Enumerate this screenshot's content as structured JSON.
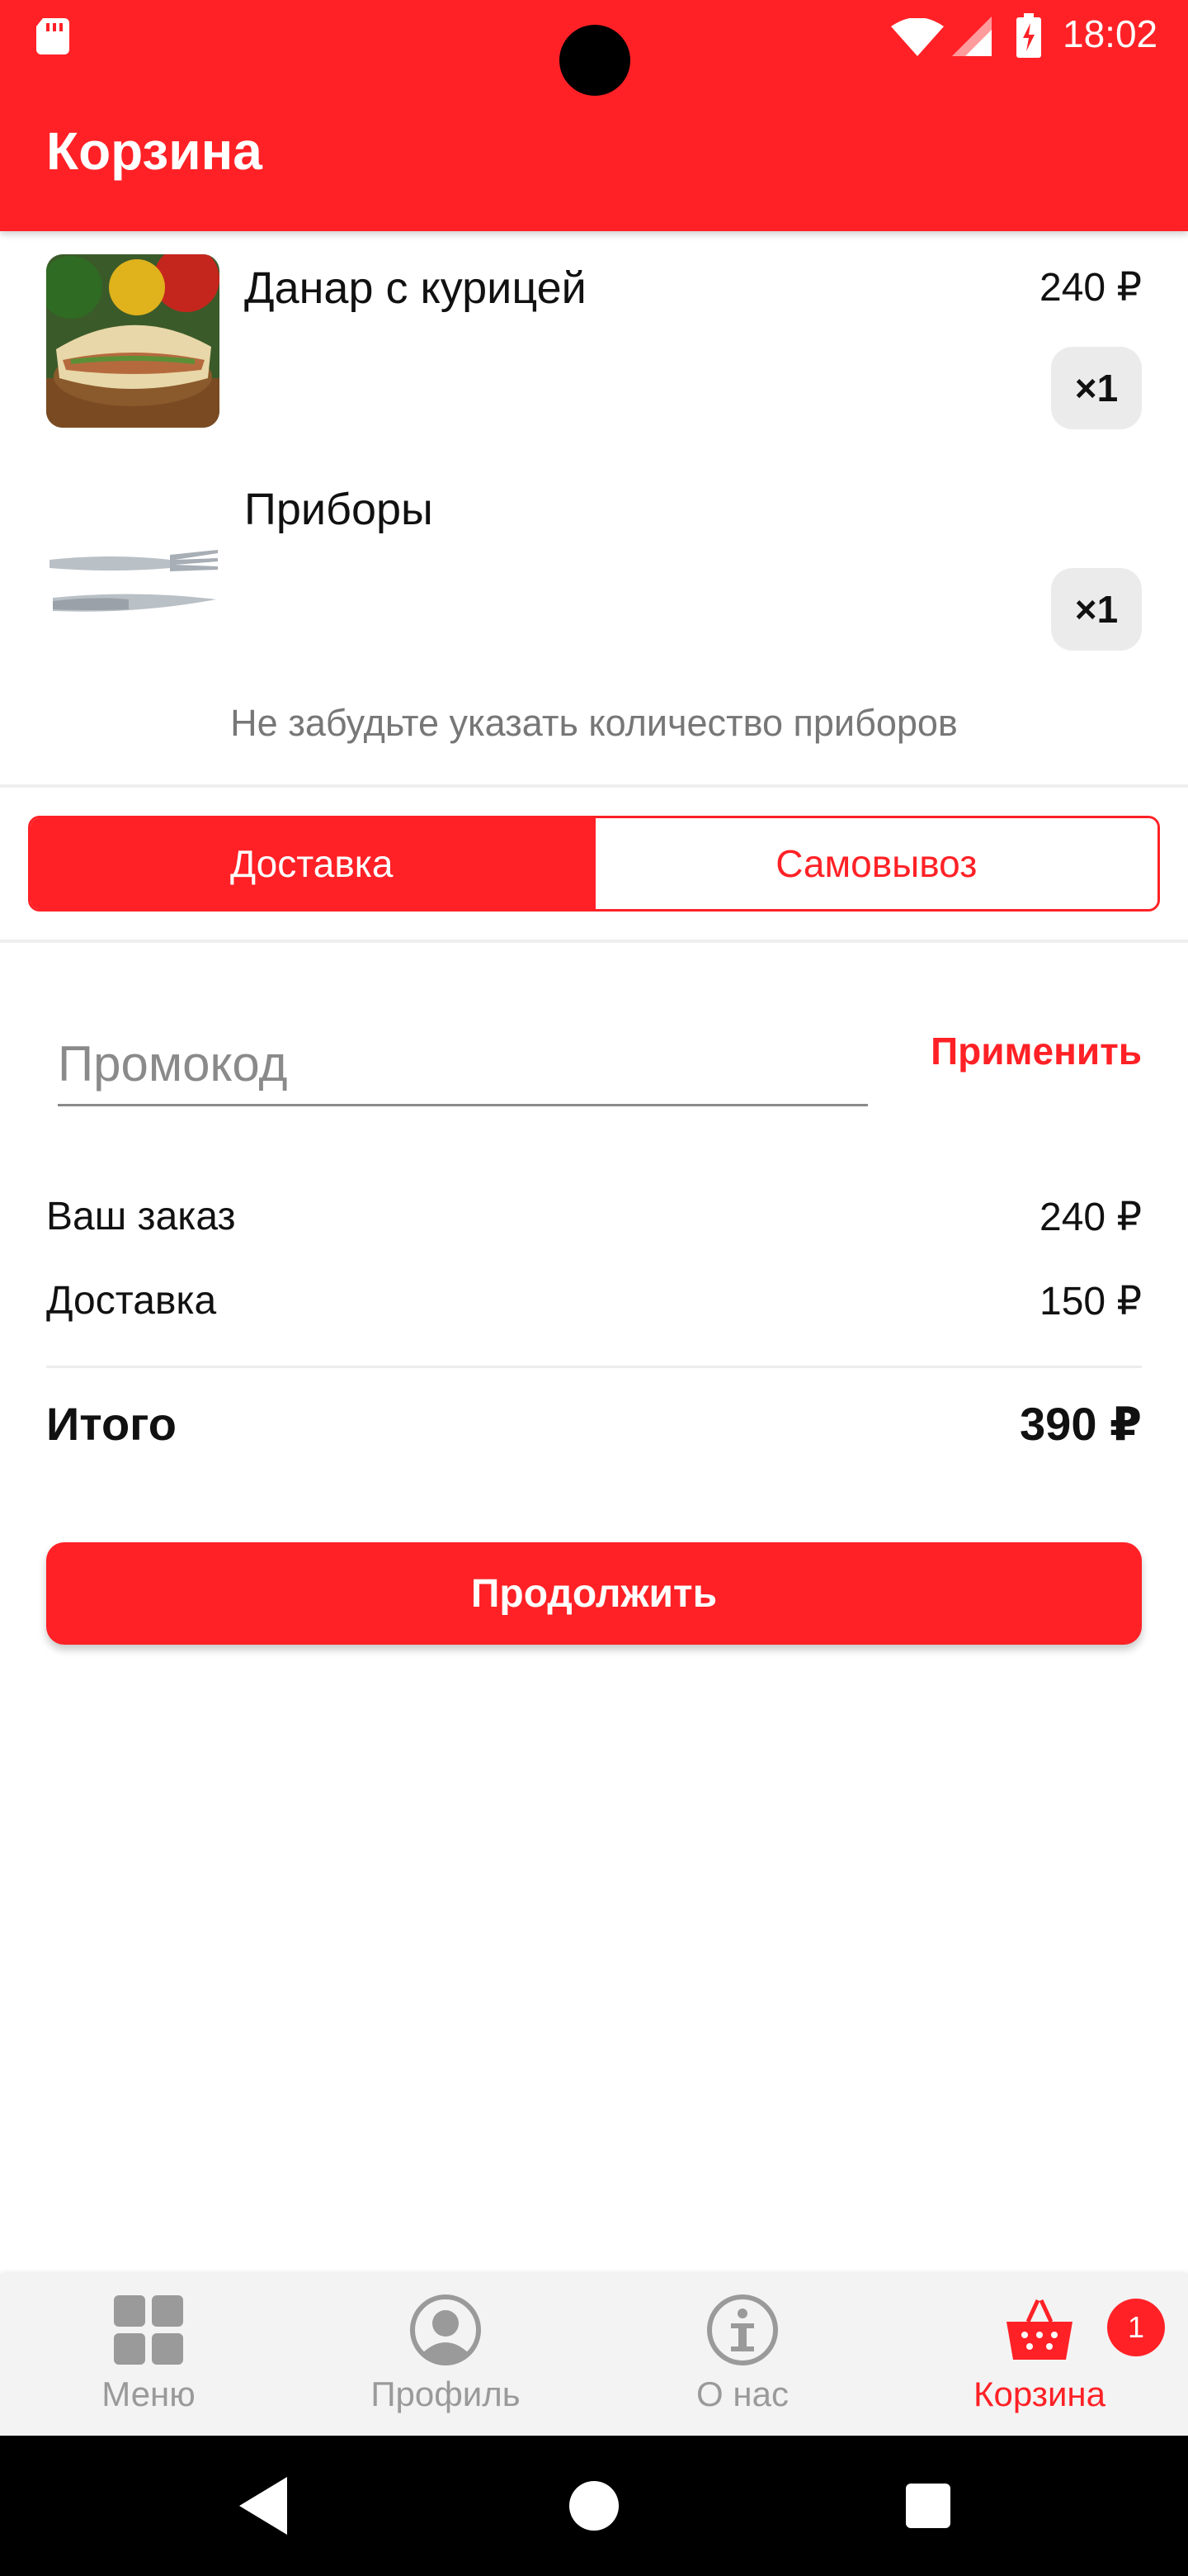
{
  "status_bar": {
    "time": "18:02"
  },
  "app_bar": {
    "title": "Корзина"
  },
  "cart": {
    "items": [
      {
        "name": "Данар с курицей",
        "price": "240 ₽",
        "quantity": "×1",
        "image": "shawarma-photo"
      },
      {
        "name": "Приборы",
        "quantity": "×1",
        "image": "cutlery-photo"
      }
    ],
    "hint": "Не забудьте указать количество приборов"
  },
  "delivery_toggle": {
    "options": [
      "Доставка",
      "Самовывоз"
    ],
    "selected": "Доставка"
  },
  "promo": {
    "placeholder": "Промокод",
    "apply_label": "Применить"
  },
  "summary": {
    "order_label": "Ваш заказ",
    "order_value": "240 ₽",
    "delivery_label": "Доставка",
    "delivery_value": "150 ₽",
    "total_label": "Итого",
    "total_value": "390 ₽"
  },
  "continue_label": "Продолжить",
  "bottom_nav": {
    "items": [
      {
        "label": "Меню",
        "icon": "grid-icon"
      },
      {
        "label": "Профиль",
        "icon": "user-icon"
      },
      {
        "label": "О нас",
        "icon": "info-icon"
      },
      {
        "label": "Корзина",
        "icon": "basket-icon"
      }
    ],
    "active": "Корзина",
    "cart_badge": "1"
  },
  "colors": {
    "accent": "#ff2126",
    "inactive": "#9a9a9a",
    "chip": "#ebebeb"
  }
}
